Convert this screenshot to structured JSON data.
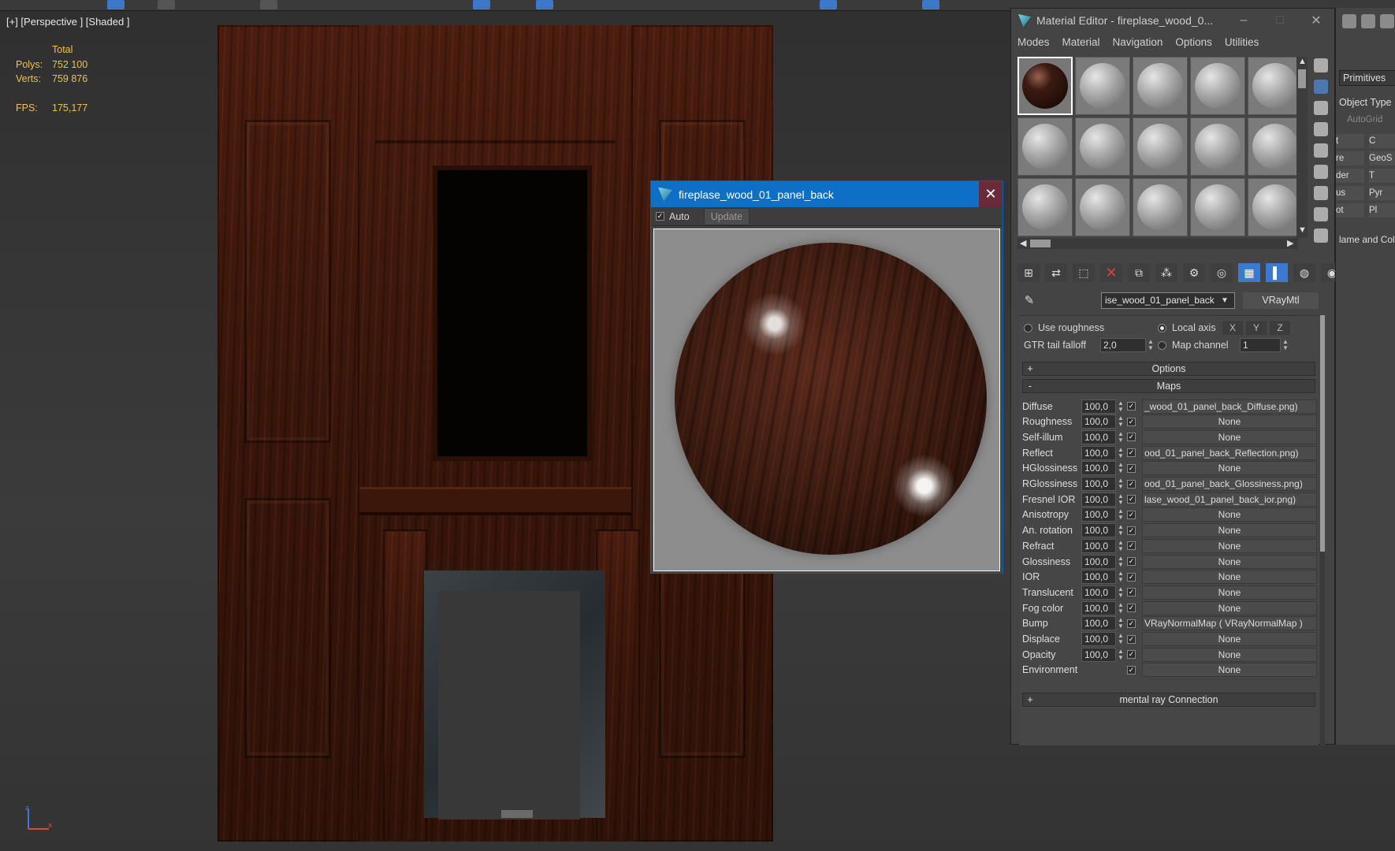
{
  "viewport": {
    "label": "[+] [Perspective ] [Shaded ]",
    "stats": {
      "header": "Total",
      "polys_label": "Polys:",
      "polys_value": "752 100",
      "verts_label": "Verts:",
      "verts_value": "759 876",
      "fps_label": "FPS:",
      "fps_value": "175,177"
    }
  },
  "preview": {
    "title": "fireplase_wood_01_panel_back",
    "auto_label": "Auto",
    "auto_checked": true,
    "update_label": "Update",
    "close_glyph": "✕"
  },
  "material_editor": {
    "title": "Material Editor - fireplase_wood_0...",
    "menu": [
      "Modes",
      "Material",
      "Navigation",
      "Options",
      "Utilities"
    ],
    "material_name": "ise_wood_01_panel_back",
    "material_type": "VRayMtl",
    "use_roughness_label": "Use roughness",
    "local_axis_label": "Local axis",
    "axis_x": "X",
    "axis_y": "Y",
    "axis_z": "Z",
    "gtr_label": "GTR tail falloff",
    "gtr_value": "2,0",
    "map_channel_label": "Map channel",
    "map_channel_value": "1",
    "options_rollout": "Options",
    "maps_rollout": "Maps",
    "mental_ray_rollout": "mental ray Connection",
    "maps": [
      {
        "name": "Diffuse",
        "amount": "100,0",
        "map": "_wood_01_panel_back_Diffuse.png)"
      },
      {
        "name": "Roughness",
        "amount": "100,0",
        "map": "None"
      },
      {
        "name": "Self-illum",
        "amount": "100,0",
        "map": "None"
      },
      {
        "name": "Reflect",
        "amount": "100,0",
        "map": "ood_01_panel_back_Reflection.png)"
      },
      {
        "name": "HGlossiness",
        "amount": "100,0",
        "map": "None"
      },
      {
        "name": "RGlossiness",
        "amount": "100,0",
        "map": "ood_01_panel_back_Glossiness.png)"
      },
      {
        "name": "Fresnel IOR",
        "amount": "100,0",
        "map": "lase_wood_01_panel_back_ior.png)"
      },
      {
        "name": "Anisotropy",
        "amount": "100,0",
        "map": "None"
      },
      {
        "name": "An. rotation",
        "amount": "100,0",
        "map": "None"
      },
      {
        "name": "Refract",
        "amount": "100,0",
        "map": "None"
      },
      {
        "name": "Glossiness",
        "amount": "100,0",
        "map": "None"
      },
      {
        "name": "IOR",
        "amount": "100,0",
        "map": "None"
      },
      {
        "name": "Translucent",
        "amount": "100,0",
        "map": "None"
      },
      {
        "name": "Fog color",
        "amount": "100,0",
        "map": "None"
      },
      {
        "name": "Bump",
        "amount": "100,0",
        "map": "VRayNormalMap  ( VRayNormalMap )"
      },
      {
        "name": "Displace",
        "amount": "100,0",
        "map": "None"
      },
      {
        "name": "Opacity",
        "amount": "100,0",
        "map": "None"
      },
      {
        "name": "Environment",
        "amount": "",
        "map": "None"
      }
    ]
  },
  "command_panel": {
    "primitives_label": "Primitives",
    "object_type_label": "Object Type",
    "autogrid_label": "AutoGrid",
    "buttons": [
      "t",
      "C",
      "re",
      "GeoS",
      "der",
      "T",
      "us",
      "Pyr",
      "ot",
      "Pl"
    ],
    "name_color_label": "lame and Colo"
  },
  "colors": {
    "title_blue": "#0e6fc7",
    "stats_yellow": "#f0c14a",
    "panel_bg": "#444444"
  }
}
